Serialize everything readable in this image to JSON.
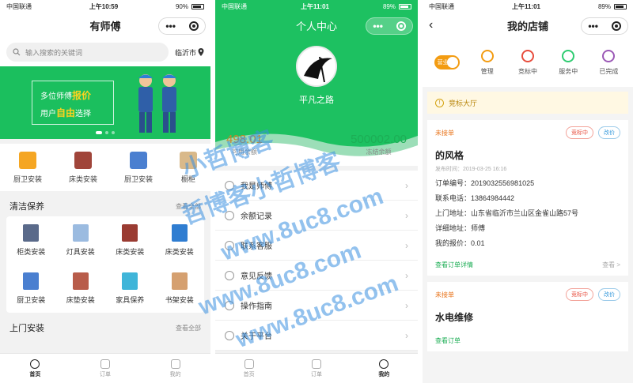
{
  "phone1": {
    "status": {
      "carrier": "中国联通",
      "time": "上午10:59",
      "battery": "90%"
    },
    "title": "有师傅",
    "search_placeholder": "输入搜索的关键词",
    "location": "临沂市",
    "banner": {
      "line1_prefix": "多位师傅",
      "line1_highlight": "报价",
      "line2_prefix": "用户",
      "line2_highlight": "自由",
      "line2_suffix": "选择"
    },
    "categories": [
      {
        "label": "厨卫安装",
        "color": "#f5a623"
      },
      {
        "label": "床类安装",
        "color": "#a0453a"
      },
      {
        "label": "厨卫安装",
        "color": "#4a7fd0"
      },
      {
        "label": "橱柜",
        "color": "#d9b98a"
      }
    ],
    "section_clean": {
      "title": "清洁保养",
      "more": "查看全部"
    },
    "grid": [
      {
        "label": "柜类安装",
        "color": "#5a6a8a"
      },
      {
        "label": "灯具安装",
        "color": "#9bbbe0"
      },
      {
        "label": "床类安装",
        "color": "#9a3b32"
      },
      {
        "label": "床类安装",
        "color": "#2f7dd1"
      },
      {
        "label": "厨卫安装",
        "color": "#4a7fd0"
      },
      {
        "label": "床垫安装",
        "color": "#b85c4a"
      },
      {
        "label": "家具保养",
        "color": "#3fb5d9"
      },
      {
        "label": "书架安装",
        "color": "#d5a070"
      }
    ],
    "section_home": {
      "title": "上门安装",
      "more": "查看全部"
    },
    "tabs": [
      "首页",
      "订单",
      "我的"
    ]
  },
  "phone2": {
    "status": {
      "carrier": "中国联通",
      "time": "上午11:01",
      "battery": "89%"
    },
    "title": "个人中心",
    "username": "平凡之路",
    "balance_left": {
      "value": "498.01",
      "label": "可用余额"
    },
    "balance_right": {
      "value": "500002.00",
      "label": "冻结余额"
    },
    "menu": [
      "我是师傅",
      "余额记录",
      "联系客服",
      "意见反馈",
      "操作指南",
      "关于平台"
    ],
    "tabs": [
      "首页",
      "订单",
      "我的"
    ]
  },
  "phone3": {
    "status": {
      "carrier": "中国联通",
      "time": "上午11:01",
      "battery": "89%"
    },
    "title": "我的店铺",
    "toggle": "营业",
    "status_tabs": [
      {
        "label": "管理",
        "color": "#f39c12"
      },
      {
        "label": "竞标中",
        "color": "#e74c3c"
      },
      {
        "label": "服务中",
        "color": "#2ecc71"
      },
      {
        "label": "已完成",
        "color": "#9b59b6"
      }
    ],
    "notice": "竞标大厅",
    "order1": {
      "status": "未接单",
      "badge1": "竞标中",
      "badge2": "改价",
      "title": "的风格",
      "time": "发布时间：2019-03-25 16:16",
      "order_no": "订单编号：2019032556981025",
      "phone": "联系电话：13864984442",
      "address": "上门地址：山东省临沂市兰山区金雀山路57号",
      "detail": "详细地址：师傅",
      "quote": "我的报价：0.01",
      "link": "查看订单详情",
      "more": "查看 >"
    },
    "order2": {
      "status": "未接单",
      "badge1": "竞标中",
      "badge2": "改价",
      "title": "水电维修",
      "link": "查看订单"
    }
  },
  "watermark": {
    "line1": "小哲博客",
    "line2": "哲博客小哲博客",
    "line3": "www.8uc8.com"
  }
}
